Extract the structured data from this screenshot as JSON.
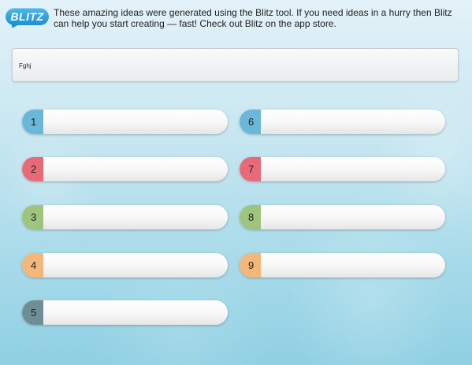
{
  "header": {
    "logo_text": "BLITZ",
    "intro": "These amazing ideas were generated using the Blitz tool. If you need ideas in a hurry then Blitz can help you start creating — fast! Check out Blitz on the app store."
  },
  "main_idea": {
    "text": "Fghj"
  },
  "slots": [
    {
      "number": "1",
      "color": "#6ab7d8"
    },
    {
      "number": "2",
      "color": "#e86a78"
    },
    {
      "number": "3",
      "color": "#9fc47e"
    },
    {
      "number": "4",
      "color": "#f3b779"
    },
    {
      "number": "5",
      "color": "#6f8d94"
    },
    {
      "number": "6",
      "color": "#6ab7d8"
    },
    {
      "number": "7",
      "color": "#e86a78"
    },
    {
      "number": "8",
      "color": "#9fc47e"
    },
    {
      "number": "9",
      "color": "#f3b779"
    }
  ]
}
